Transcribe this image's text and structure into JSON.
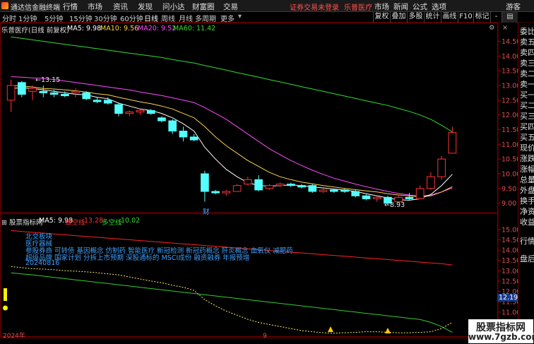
{
  "app": {
    "name": "通达信金融终端"
  },
  "menu": [
    "行情",
    "市场",
    "资讯",
    "发现",
    "问小达",
    "财富圈",
    "交易"
  ],
  "notice": {
    "login": "证券交易未登录",
    "stock": "乐普医疗"
  },
  "right_menu": [
    "市场",
    "新闻",
    "公式",
    "选项",
    "游客"
  ],
  "periods": [
    "分时",
    "1分钟",
    "5分钟",
    "15分钟",
    "30分钟",
    "60分钟",
    "日线",
    "周线",
    "月线",
    "多周期",
    "更多"
  ],
  "active_period": "日线",
  "toolbar_right": [
    "复权",
    "叠加",
    "多股",
    "统计",
    "画线",
    "F10",
    "标记",
    "-"
  ],
  "chart": {
    "title": "乐普医疗(日线 前复权)",
    "ma": [
      {
        "label": "MA5: 9.98",
        "color": "#ffffff"
      },
      {
        "label": "MA10: 9.56",
        "color": "#ffd24a"
      },
      {
        "label": "MA20: 9.52",
        "color": "#ff4cff"
      },
      {
        "label": "MA60: 11.42",
        "color": "#33dd33"
      }
    ],
    "high_label": "13.15",
    "low_label": "8.93",
    "cai_label": "财",
    "y_ticks": [
      "14.50",
      "14.00",
      "13.50",
      "13.00",
      "12.50",
      "12.00",
      "11.50",
      "11.00",
      "10.50",
      "10.00",
      "9.50",
      "9.00"
    ]
  },
  "indicator": {
    "name": "股票指标网",
    "ma5": "MA5: 9.98",
    "empty_label": "做空线",
    "empty_val": "13.28",
    "long_label": "多空线",
    "long_val": "10.02",
    "lines": [
      "北交板块",
      "医疗器械",
      "参股券商 可转债 基因概念 仿制药 智能医疗 新冠检测 新冠药概念 肝炎概念 血氧仪 减肥药",
      "超级品牌 国家计划 分拆上市预期 深股通标的 MSCI成份 融资融券 年报预增",
      "20240816"
    ],
    "y_ticks": [
      "15.00",
      "14.50",
      "14.00",
      "13.50",
      "13.00",
      "12.50",
      "12.00",
      "11.50",
      "11.00",
      "10.50",
      "10.00"
    ],
    "current": "12.19",
    "x_labels": [
      "2024年",
      "9"
    ]
  },
  "right_panel": [
    "委比",
    "卖五",
    "卖四",
    "卖三",
    "卖二",
    "卖一",
    "买一",
    "买二",
    "买三",
    "买四",
    "买五",
    "现价",
    "涨跌",
    "涨幅",
    "总量",
    "外盘",
    "换手",
    "净资",
    "收益",
    "行情",
    "盘后",
    "行情"
  ],
  "watermark": {
    "line1": "股票指标网",
    "line2": "www.7gzb.com"
  },
  "chart_data": [
    {
      "type": "candlestick",
      "title": "乐普医疗(日线 前复权)",
      "y_range": [
        8.8,
        14.8
      ],
      "candles": [
        {
          "o": 12.5,
          "h": 13.2,
          "l": 12.1,
          "c": 13.0
        },
        {
          "o": 13.1,
          "h": 13.15,
          "l": 12.6,
          "c": 12.7
        },
        {
          "o": 12.8,
          "h": 13.0,
          "l": 12.5,
          "c": 12.9
        },
        {
          "o": 12.8,
          "h": 13.0,
          "l": 12.6,
          "c": 12.75
        },
        {
          "o": 12.75,
          "h": 12.85,
          "l": 12.6,
          "c": 12.7
        },
        {
          "o": 12.7,
          "h": 12.8,
          "l": 12.6,
          "c": 12.65
        },
        {
          "o": 12.75,
          "h": 12.9,
          "l": 12.6,
          "c": 12.8
        },
        {
          "o": 12.75,
          "h": 12.8,
          "l": 12.5,
          "c": 12.55
        },
        {
          "o": 12.5,
          "h": 12.6,
          "l": 12.4,
          "c": 12.45
        },
        {
          "o": 12.5,
          "h": 12.6,
          "l": 12.35,
          "c": 12.4
        },
        {
          "o": 12.35,
          "h": 12.4,
          "l": 11.95,
          "c": 12.05
        },
        {
          "o": 12.05,
          "h": 12.15,
          "l": 11.95,
          "c": 12.1
        },
        {
          "o": 12.1,
          "h": 12.2,
          "l": 12.0,
          "c": 12.15
        },
        {
          "o": 12.15,
          "h": 12.2,
          "l": 12.0,
          "c": 12.05
        },
        {
          "o": 11.9,
          "h": 11.95,
          "l": 11.75,
          "c": 11.8
        },
        {
          "o": 11.8,
          "h": 11.85,
          "l": 11.35,
          "c": 11.45
        },
        {
          "o": 11.45,
          "h": 11.6,
          "l": 11.1,
          "c": 11.25
        },
        {
          "o": 11.25,
          "h": 11.35,
          "l": 11.1,
          "c": 11.15
        },
        {
          "o": 10.0,
          "h": 10.1,
          "l": 9.05,
          "c": 9.4
        },
        {
          "o": 9.4,
          "h": 9.45,
          "l": 9.3,
          "c": 9.35
        },
        {
          "o": 9.35,
          "h": 9.45,
          "l": 9.25,
          "c": 9.4
        },
        {
          "o": 9.4,
          "h": 9.65,
          "l": 9.4,
          "c": 9.6
        },
        {
          "o": 9.65,
          "h": 9.9,
          "l": 9.6,
          "c": 9.8
        },
        {
          "o": 9.8,
          "h": 9.95,
          "l": 9.4,
          "c": 9.45
        },
        {
          "o": 9.5,
          "h": 9.65,
          "l": 9.45,
          "c": 9.6
        },
        {
          "o": 9.6,
          "h": 9.7,
          "l": 9.55,
          "c": 9.65
        },
        {
          "o": 9.65,
          "h": 9.7,
          "l": 9.55,
          "c": 9.6
        },
        {
          "o": 9.6,
          "h": 9.65,
          "l": 9.5,
          "c": 9.55
        },
        {
          "o": 9.6,
          "h": 9.65,
          "l": 9.35,
          "c": 9.4
        },
        {
          "o": 9.4,
          "h": 9.5,
          "l": 9.35,
          "c": 9.45
        },
        {
          "o": 9.45,
          "h": 9.5,
          "l": 9.35,
          "c": 9.4
        },
        {
          "o": 9.45,
          "h": 9.5,
          "l": 9.35,
          "c": 9.4
        },
        {
          "o": 9.4,
          "h": 9.45,
          "l": 9.2,
          "c": 9.25
        },
        {
          "o": 9.25,
          "h": 9.3,
          "l": 9.1,
          "c": 9.15
        },
        {
          "o": 9.15,
          "h": 9.25,
          "l": 9.05,
          "c": 9.2
        },
        {
          "o": 9.2,
          "h": 9.25,
          "l": 8.93,
          "c": 9.0
        },
        {
          "o": 9.05,
          "h": 9.3,
          "l": 9.0,
          "c": 9.2
        },
        {
          "o": 9.2,
          "h": 9.35,
          "l": 9.1,
          "c": 9.15
        },
        {
          "o": 9.15,
          "h": 9.6,
          "l": 9.15,
          "c": 9.5
        },
        {
          "o": 9.5,
          "h": 10.05,
          "l": 9.45,
          "c": 9.9
        },
        {
          "o": 9.9,
          "h": 10.6,
          "l": 9.8,
          "c": 10.5
        },
        {
          "o": 10.7,
          "h": 11.6,
          "l": 10.7,
          "c": 11.4
        }
      ],
      "ma": [
        {
          "name": "MA5",
          "values": [
            12.9,
            12.92,
            12.9,
            12.85,
            12.8,
            12.75,
            12.7,
            12.68,
            12.6,
            12.55,
            12.4,
            12.3,
            12.2,
            12.15,
            12.05,
            11.9,
            11.7,
            11.45,
            10.9,
            10.5,
            10.15,
            9.9,
            9.7,
            9.6,
            9.58,
            9.6,
            9.62,
            9.6,
            9.55,
            9.52,
            9.48,
            9.45,
            9.4,
            9.32,
            9.25,
            9.18,
            9.12,
            9.1,
            9.15,
            9.3,
            9.6,
            9.98
          ]
        },
        {
          "name": "MA10",
          "values": [
            13.0,
            12.98,
            12.95,
            12.9,
            12.88,
            12.85,
            12.82,
            12.78,
            12.72,
            12.68,
            12.6,
            12.52,
            12.44,
            12.38,
            12.3,
            12.2,
            12.05,
            11.9,
            11.6,
            11.25,
            10.95,
            10.7,
            10.45,
            10.25,
            10.05,
            9.9,
            9.8,
            9.72,
            9.66,
            9.6,
            9.55,
            9.5,
            9.46,
            9.42,
            9.38,
            9.32,
            9.28,
            9.25,
            9.22,
            9.25,
            9.38,
            9.56
          ]
        },
        {
          "name": "MA20",
          "values": [
            13.3,
            13.28,
            13.26,
            13.24,
            13.2,
            13.15,
            13.1,
            13.05,
            13.0,
            12.95,
            12.9,
            12.85,
            12.78,
            12.72,
            12.66,
            12.58,
            12.5,
            12.42,
            12.25,
            12.05,
            11.85,
            11.6,
            11.35,
            11.1,
            10.85,
            10.65,
            10.45,
            10.28,
            10.12,
            9.98,
            9.85,
            9.75,
            9.65,
            9.56,
            9.48,
            9.4,
            9.33,
            9.28,
            9.24,
            9.28,
            9.38,
            9.52
          ]
        },
        {
          "name": "MA60",
          "values": [
            14.65,
            14.6,
            14.55,
            14.5,
            14.45,
            14.4,
            14.35,
            14.3,
            14.25,
            14.2,
            14.15,
            14.1,
            14.05,
            14.0,
            13.95,
            13.88,
            13.82,
            13.76,
            13.68,
            13.6,
            13.52,
            13.44,
            13.36,
            13.28,
            13.2,
            13.12,
            13.04,
            12.96,
            12.88,
            12.8,
            12.72,
            12.64,
            12.56,
            12.48,
            12.4,
            12.32,
            12.22,
            12.12,
            12.0,
            11.85,
            11.65,
            11.42
          ]
        }
      ]
    },
    {
      "type": "line",
      "title": "股票指标网",
      "y_range": [
        9.9,
        15.3
      ],
      "series": [
        {
          "name": "做空线",
          "values": [
            14.95,
            14.9,
            14.86,
            14.82,
            14.78,
            14.74,
            14.7,
            14.66,
            14.62,
            14.58,
            14.54,
            14.5,
            14.46,
            14.42,
            14.38,
            14.34,
            14.3,
            14.26,
            14.22,
            14.18,
            14.14,
            14.1,
            14.06,
            14.02,
            13.98,
            13.94,
            13.9,
            13.86,
            13.82,
            13.78,
            13.74,
            13.7,
            13.66,
            13.62,
            13.58,
            13.54,
            13.5,
            13.46,
            13.42,
            13.38,
            13.34,
            13.28
          ]
        },
        {
          "name": "多空线",
          "values": [
            12.9,
            12.85,
            12.8,
            12.74,
            12.68,
            12.62,
            12.56,
            12.5,
            12.44,
            12.38,
            12.32,
            12.26,
            12.2,
            12.14,
            12.08,
            12.02,
            11.96,
            11.9,
            11.84,
            11.78,
            11.72,
            11.66,
            11.6,
            11.54,
            11.48,
            11.42,
            11.36,
            11.3,
            11.24,
            11.18,
            11.12,
            11.06,
            11.0,
            10.94,
            10.88,
            10.82,
            10.76,
            10.7,
            10.64,
            10.5,
            10.3,
            10.02
          ]
        },
        {
          "name": "",
          "values": [
            13.2,
            13.15,
            13.1,
            13.08,
            13.05,
            13.0,
            12.98,
            12.95,
            12.9,
            12.85,
            12.8,
            12.7,
            12.6,
            12.5,
            12.42,
            12.3,
            12.2,
            12.05,
            11.6,
            11.3,
            11.05,
            10.85,
            10.65,
            10.5,
            10.4,
            10.3,
            10.2,
            10.1,
            10.05,
            10.0,
            9.98,
            10.0,
            10.02,
            10.05,
            10.05,
            10.02,
            10.0,
            10.0,
            10.02,
            10.05,
            10.2,
            10.5
          ]
        }
      ]
    }
  ]
}
